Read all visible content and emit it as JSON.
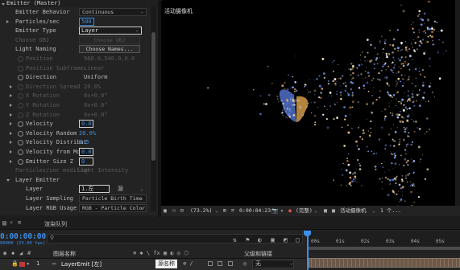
{
  "effect_panel": {
    "section_title": "Emitter (Master)",
    "rows": [
      {
        "label": "Emitter Behavior",
        "value": "Continuous",
        "kind": "dropdown",
        "indent": 1,
        "dim": false
      },
      {
        "label": "Particles/sec",
        "value": "500",
        "kind": "box",
        "indent": 1,
        "dim": false,
        "expand": true
      },
      {
        "label": "Emitter Type",
        "value": "Layer",
        "kind": "box-dd",
        "indent": 1,
        "dim": false
      },
      {
        "label": "Choose OBJ",
        "value": "Choose OBJ",
        "kind": "button",
        "indent": 1,
        "dim": true
      },
      {
        "label": "Light Naming",
        "value": "Choose Names...",
        "kind": "button",
        "indent": 1,
        "dim": false
      },
      {
        "label": "Position",
        "value": "960.0,540.0,0.0",
        "kind": "dimtext",
        "indent": 2,
        "dim": true,
        "stopwatch": true
      },
      {
        "label": "Position Subframe",
        "value": "Linear",
        "kind": "dimtext",
        "indent": 2,
        "dim": true,
        "stopwatch": true
      },
      {
        "label": "Direction",
        "value": "Uniform",
        "kind": "text",
        "indent": 2,
        "dim": false,
        "stopwatch": true
      },
      {
        "label": "Direction Spread",
        "value": "20.0%",
        "kind": "dimtext",
        "indent": 2,
        "dim": true,
        "expand": true,
        "stopwatch": true
      },
      {
        "label": "X Rotation",
        "value": "0x+0.0°",
        "kind": "dimtext",
        "indent": 2,
        "dim": true,
        "expand": true,
        "stopwatch": true
      },
      {
        "label": "Y Rotation",
        "value": "0x+0.0°",
        "kind": "dimtext",
        "indent": 2,
        "dim": true,
        "expand": true,
        "stopwatch": true
      },
      {
        "label": "Z Rotation",
        "value": "0x+0.0°",
        "kind": "dimtext",
        "indent": 2,
        "dim": true,
        "expand": true,
        "stopwatch": true
      },
      {
        "label": "Velocity",
        "value": "0.0",
        "kind": "bluebox",
        "indent": 2,
        "dim": false,
        "expand": true,
        "stopwatch": true
      },
      {
        "label": "Velocity Random",
        "value": "20.0%",
        "kind": "blue",
        "indent": 2,
        "dim": false,
        "expand": true,
        "stopwatch": true
      },
      {
        "label": "Velocity Distribut",
        "value": "0.5",
        "kind": "blue",
        "indent": 2,
        "dim": false,
        "expand": true,
        "stopwatch": true
      },
      {
        "label": "Velocity from Moti",
        "value": "0.0",
        "kind": "bluebox",
        "indent": 2,
        "dim": false,
        "expand": true,
        "stopwatch": true
      },
      {
        "label": "Emitter Size Z",
        "value": "0",
        "kind": "bluebox",
        "indent": 2,
        "dim": false,
        "expand": true,
        "stopwatch": true
      },
      {
        "label": "Particles/sec modifier",
        "value": "Light Intensity",
        "kind": "dimtext",
        "indent": 1,
        "dim": true
      },
      {
        "label": "Layer Emitter",
        "value": "",
        "kind": "section",
        "indent": 1,
        "dim": false,
        "open": true
      },
      {
        "label": "Layer",
        "value": "1.左",
        "kind": "layer",
        "indent": 2,
        "dim": false,
        "extra": "源"
      },
      {
        "label": "Layer Sampling",
        "value": "Particle Birth Time",
        "kind": "dropdown",
        "indent": 2,
        "dim": false
      },
      {
        "label": "Layer RGB Usage",
        "value": "RGB - Particle Color",
        "kind": "dropdown",
        "indent": 2,
        "dim": false
      }
    ]
  },
  "viewer": {
    "title": "活动摄像机",
    "toolbar": {
      "zoom": "(73.2%)",
      "timecode": "0:00:04:23",
      "quality": "(完整)",
      "camera": "活动摄像机",
      "views": "1 个..."
    }
  },
  "timeline": {
    "panel_icon": "composition-icon",
    "tab_label": "渲染队列",
    "timecode": "0:00:00:00",
    "timecode_sub": "00000 (25.00 fps)",
    "search_placeholder": "",
    "col_layer_name": "图层名称",
    "col_parent": "父级和链接",
    "layer": {
      "number": "1",
      "name": "LayerEmit [左]",
      "tooltip": "源名称",
      "parent": "无"
    },
    "ruler_ticks": [
      "00s",
      "01s",
      "02s",
      "03s",
      "04s",
      "05s"
    ]
  },
  "colors": {
    "accent": "#3d8fe8",
    "panel_bg": "#232323",
    "viewer_bg": "#000000",
    "layer_bar": "#6a5848"
  }
}
